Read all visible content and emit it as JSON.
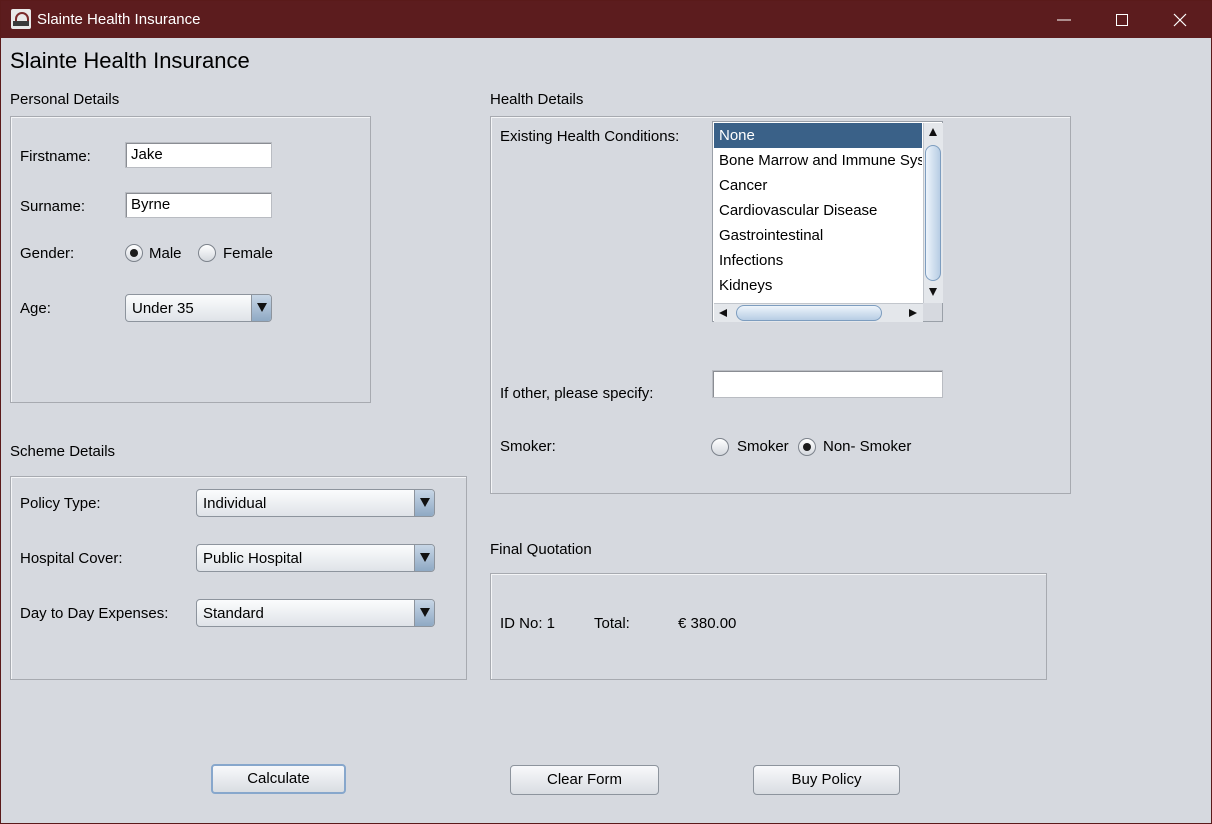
{
  "window": {
    "title": "Slainte Health Insurance"
  },
  "header": {
    "title": "Slainte Health Insurance"
  },
  "personal": {
    "section_title": "Personal Details",
    "firstname_label": "Firstname:",
    "firstname_value": "Jake",
    "surname_label": "Surname:",
    "surname_value": "Byrne",
    "gender_label": "Gender:",
    "gender_options": [
      "Male",
      "Female"
    ],
    "gender_selected": "Male",
    "age_label": "Age:",
    "age_value": "Under 35"
  },
  "scheme": {
    "section_title": "Scheme Details",
    "policy_type_label": "Policy Type:",
    "policy_type_value": "Individual",
    "hospital_cover_label": "Hospital Cover:",
    "hospital_cover_value": "Public Hospital",
    "expenses_label": "Day to Day Expenses:",
    "expenses_value": "Standard"
  },
  "health": {
    "section_title": "Health Details",
    "conditions_label": "Existing Health Conditions:",
    "conditions": [
      "None",
      "Bone Marrow and Immune System",
      "Cancer",
      "Cardiovascular Disease",
      "Gastrointestinal",
      "Infections",
      "Kidneys"
    ],
    "conditions_selected": "None",
    "other_label": "If other, please specify:",
    "other_value": "",
    "smoker_label": "Smoker:",
    "smoker_options": [
      "Smoker",
      "Non- Smoker"
    ],
    "smoker_selected": "Non- Smoker"
  },
  "quotation": {
    "section_title": "Final Quotation",
    "id_label": "ID No: 1",
    "total_label": "Total:",
    "total_value": "€ 380.00"
  },
  "buttons": {
    "calculate": "Calculate",
    "clear": "Clear Form",
    "buy": "Buy Policy"
  }
}
